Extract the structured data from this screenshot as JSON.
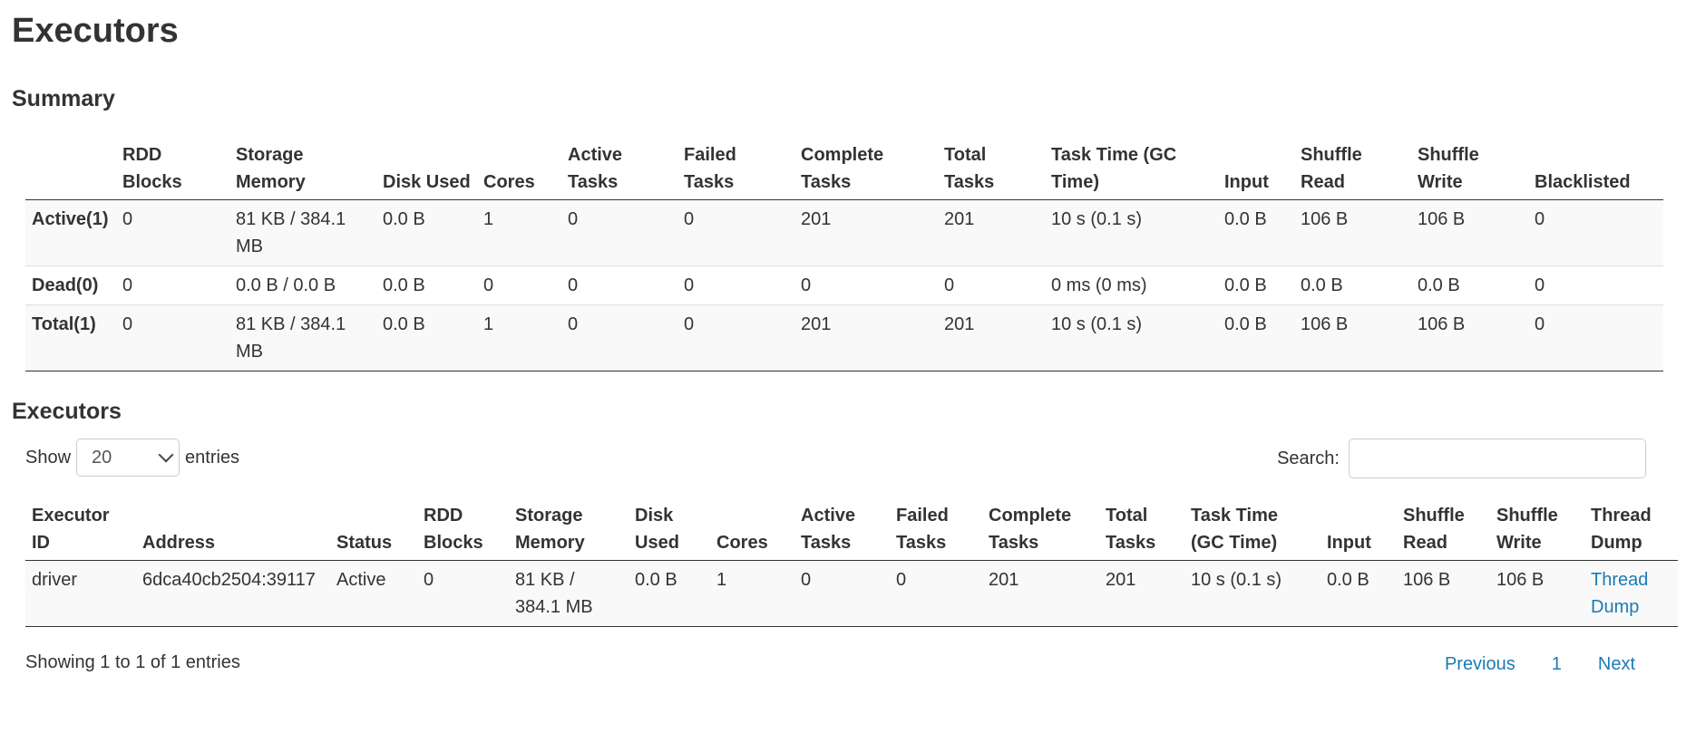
{
  "page": {
    "title": "Executors"
  },
  "summary": {
    "title": "Summary",
    "columns": [
      "",
      "RDD Blocks",
      "Storage Memory",
      "Disk Used",
      "Cores",
      "Active Tasks",
      "Failed Tasks",
      "Complete Tasks",
      "Total Tasks",
      "Task Time (GC Time)",
      "Input",
      "Shuffle Read",
      "Shuffle Write",
      "Blacklisted"
    ],
    "rows": [
      [
        "Active(1)",
        "0",
        "81 KB / 384.1 MB",
        "0.0 B",
        "1",
        "0",
        "0",
        "201",
        "201",
        "10 s (0.1 s)",
        "0.0 B",
        "106 B",
        "106 B",
        "0"
      ],
      [
        "Dead(0)",
        "0",
        "0.0 B / 0.0 B",
        "0.0 B",
        "0",
        "0",
        "0",
        "0",
        "0",
        "0 ms (0 ms)",
        "0.0 B",
        "0.0 B",
        "0.0 B",
        "0"
      ],
      [
        "Total(1)",
        "0",
        "81 KB / 384.1 MB",
        "0.0 B",
        "1",
        "0",
        "0",
        "201",
        "201",
        "10 s (0.1 s)",
        "0.0 B",
        "106 B",
        "106 B",
        "0"
      ]
    ]
  },
  "executors": {
    "title": "Executors",
    "show_label": "Show",
    "entries_label": "entries",
    "page_size": "20",
    "search_label": "Search:",
    "search_value": "",
    "columns": [
      "Executor ID",
      "Address",
      "Status",
      "RDD Blocks",
      "Storage Memory",
      "Disk Used",
      "Cores",
      "Active Tasks",
      "Failed Tasks",
      "Complete Tasks",
      "Total Tasks",
      "Task Time (GC Time)",
      "Input",
      "Shuffle Read",
      "Shuffle Write",
      "Thread Dump"
    ],
    "rows": [
      [
        "driver",
        "6dca40cb2504:39117",
        "Active",
        "0",
        "81 KB / 384.1 MB",
        "0.0 B",
        "1",
        "0",
        "0",
        "201",
        "201",
        "10 s (0.1 s)",
        "0.0 B",
        "106 B",
        "106 B",
        "Thread Dump"
      ]
    ],
    "info": "Showing 1 to 1 of 1 entries",
    "pagination": {
      "previous": "Previous",
      "current": "1",
      "next": "Next"
    },
    "colors": {
      "link": "#1b7bb5"
    }
  }
}
